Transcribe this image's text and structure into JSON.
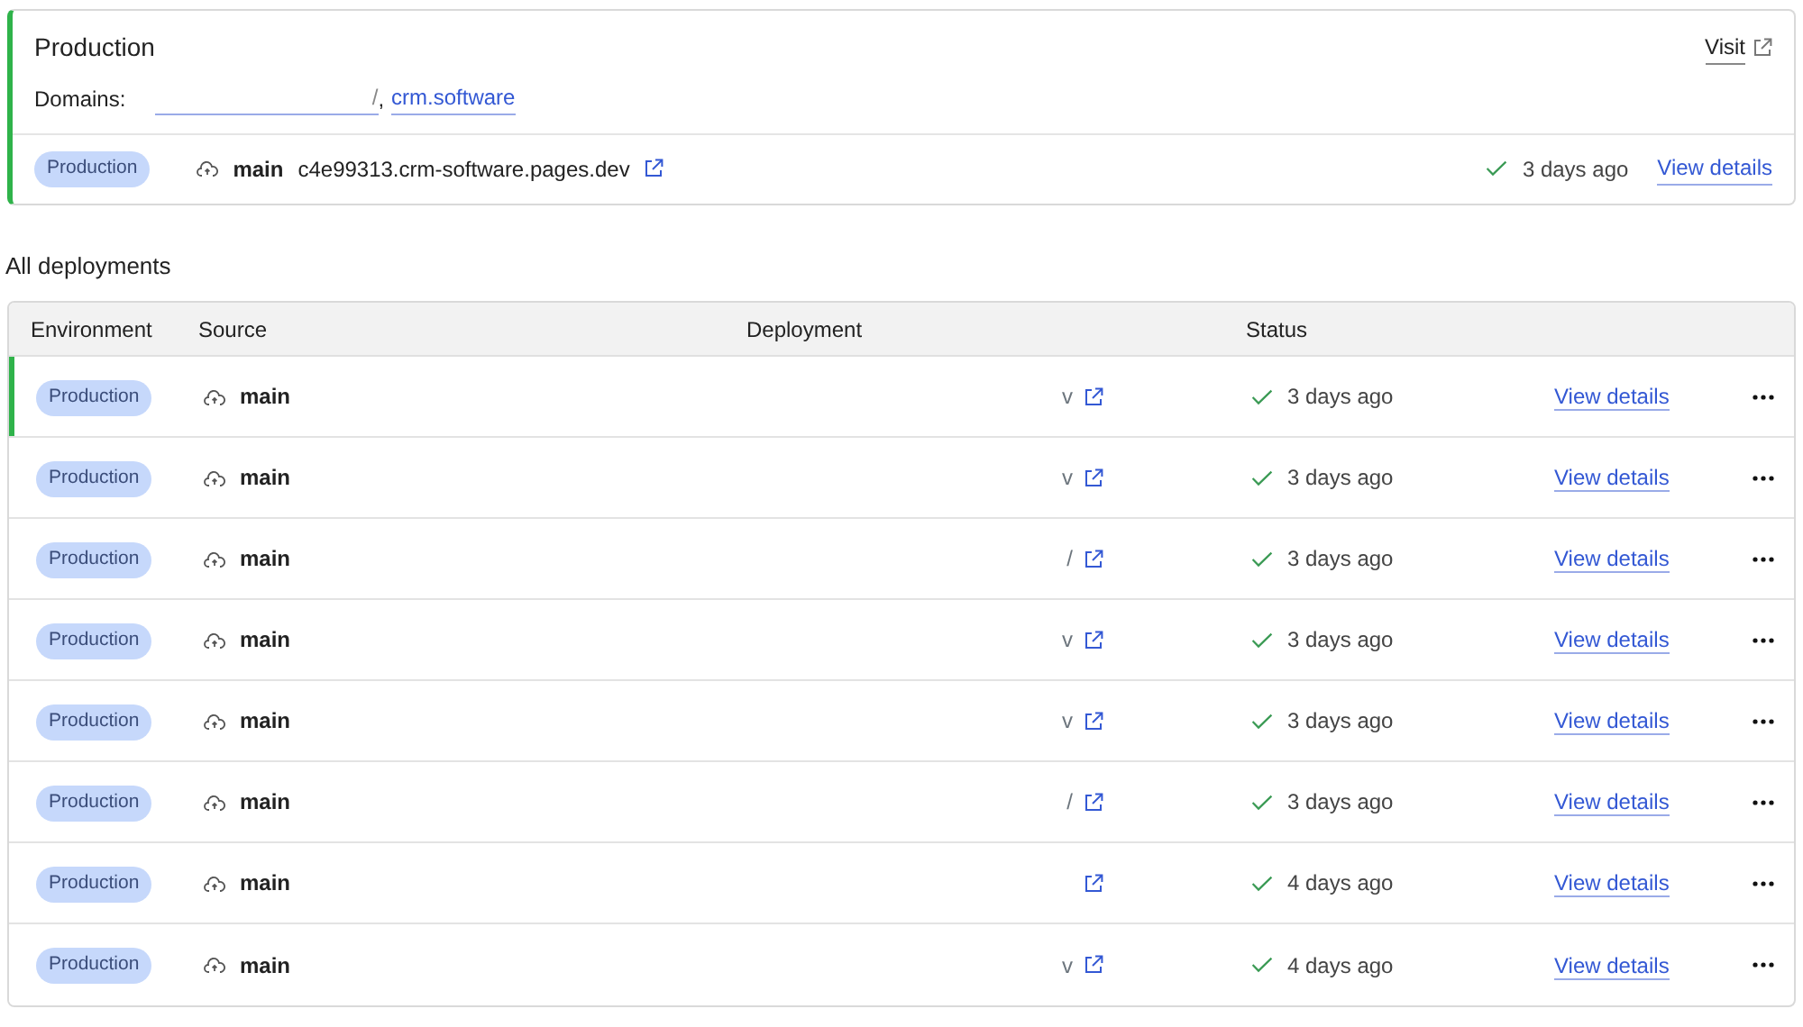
{
  "production": {
    "title": "Production",
    "visit": "Visit",
    "domains_label": "Domains:",
    "domains": [
      "/",
      "crm.software"
    ],
    "domain_separator": ",",
    "deployment": {
      "environment": "Production",
      "branch": "main",
      "url": "c4e99313.crm-software.pages.dev",
      "status": "3 days ago",
      "success": true,
      "details": "View details"
    }
  },
  "section_title": "All deployments",
  "table": {
    "columns": [
      "Environment",
      "Source",
      "Deployment",
      "Status"
    ],
    "rows": [
      {
        "environment": "Production",
        "branch": "main",
        "deployment": "v",
        "status": "3 days ago",
        "success": true,
        "current": true,
        "details": "View details"
      },
      {
        "environment": "Production",
        "branch": "main",
        "deployment": "v",
        "status": "3 days ago",
        "success": true,
        "current": false,
        "details": "View details"
      },
      {
        "environment": "Production",
        "branch": "main",
        "deployment": "/",
        "status": "3 days ago",
        "success": true,
        "current": false,
        "details": "View details"
      },
      {
        "environment": "Production",
        "branch": "main",
        "deployment": "v",
        "status": "3 days ago",
        "success": true,
        "current": false,
        "details": "View details"
      },
      {
        "environment": "Production",
        "branch": "main",
        "deployment": "v",
        "status": "3 days ago",
        "success": true,
        "current": false,
        "details": "View details"
      },
      {
        "environment": "Production",
        "branch": "main",
        "deployment": "/",
        "status": "3 days ago",
        "success": true,
        "current": false,
        "details": "View details"
      },
      {
        "environment": "Production",
        "branch": "main",
        "status": "4 days ago",
        "success": true,
        "current": false,
        "details": "View details"
      },
      {
        "environment": "Production",
        "branch": "main",
        "deployment": "v",
        "status": "4 days ago",
        "success": true,
        "current": false,
        "details": "View details"
      }
    ]
  }
}
